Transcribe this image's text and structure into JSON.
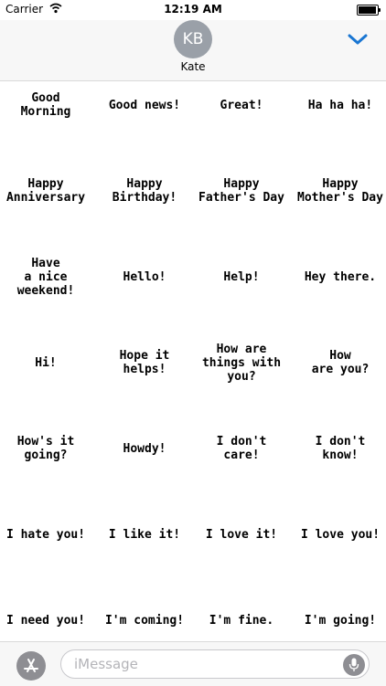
{
  "status_bar": {
    "carrier": "Carrier",
    "time": "12:19 AM",
    "battery_level": 0.95
  },
  "header": {
    "avatar_initials": "KB",
    "contact_name": "Kate"
  },
  "stickers": [
    "Good\nMorning",
    "Good news!",
    "Great!",
    "Ha ha ha!",
    "Happy\nAnniversary",
    "Happy\nBirthday!",
    "Happy\nFather's Day",
    "Happy\nMother's Day",
    "Have\na nice\nweekend!",
    "Hello!",
    "Help!",
    "Hey there.",
    "Hi!",
    "Hope it\nhelps!",
    "How are\nthings with\nyou?",
    "How\nare you?",
    "How's it\ngoing?",
    "Howdy!",
    "I don't\ncare!",
    "I don't\nknow!",
    "I hate you!",
    "I like it!",
    "I love it!",
    "I love you!",
    "I need you!",
    "I'm coming!",
    "I'm fine.",
    "I'm going!"
  ],
  "composer": {
    "placeholder": "iMessage"
  },
  "colors": {
    "accent": "#1a76d2",
    "chrome": "#f7f7f7",
    "icon_gray": "#8e8e93",
    "avatar_gray": "#9aa0a8"
  },
  "icons": [
    "wifi-icon",
    "battery-icon",
    "chevron-down-icon",
    "app-store-icon",
    "microphone-icon"
  ]
}
